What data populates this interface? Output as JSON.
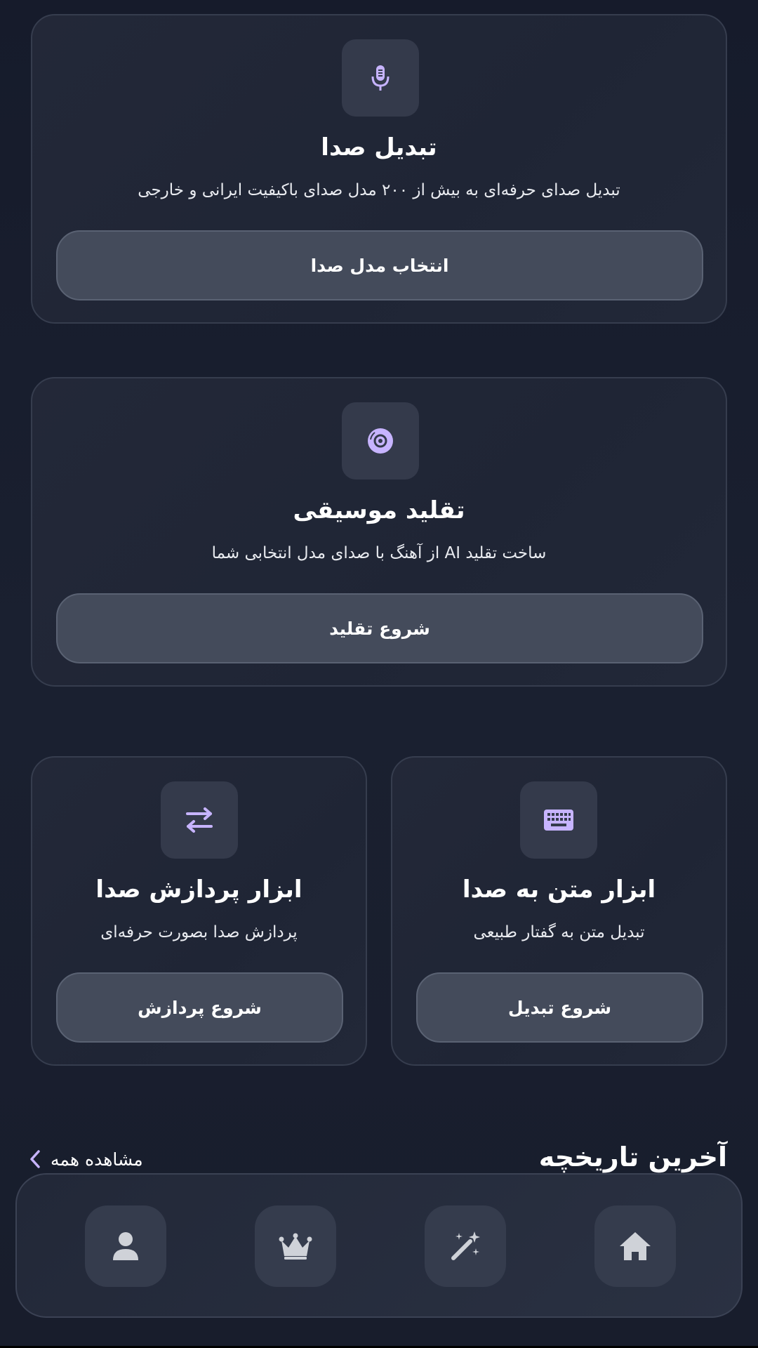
{
  "cards": {
    "voice_conversion": {
      "icon": "microphone-icon",
      "title": "تبدیل صدا",
      "description": "تبدیل صدای حرفه‌ای به بیش از ۲۰۰ مدل صدای باکیفیت ایرانی و خارجی",
      "button_label": "انتخاب مدل صدا"
    },
    "music_cover": {
      "icon": "vinyl-disc-icon",
      "title": "تقلید موسیقی",
      "description": "ساخت تقلید AI از آهنگ با صدای مدل انتخابی شما",
      "button_label": "شروع تقلید"
    },
    "text_to_speech": {
      "icon": "keyboard-icon",
      "title": "ابزار متن به صدا",
      "description": "تبدیل متن به گفتار طبیعی",
      "button_label": "شروع تبدیل"
    },
    "audio_processing": {
      "icon": "swap-arrows-icon",
      "title": "ابزار پردازش صدا",
      "description": "پردازش صدا بصورت حرفه‌ای",
      "button_label": "شروع پردازش"
    }
  },
  "history": {
    "title": "آخرین تاریخچه",
    "view_all_label": "مشاهده همه"
  },
  "nav": {
    "items": [
      "home-icon",
      "magic-wand-icon",
      "crown-icon",
      "user-icon"
    ]
  },
  "colors": {
    "accent": "#c7b4ff",
    "background": "#181d2c",
    "card_border": "#363d4e",
    "button_bg": "#444b5b"
  }
}
